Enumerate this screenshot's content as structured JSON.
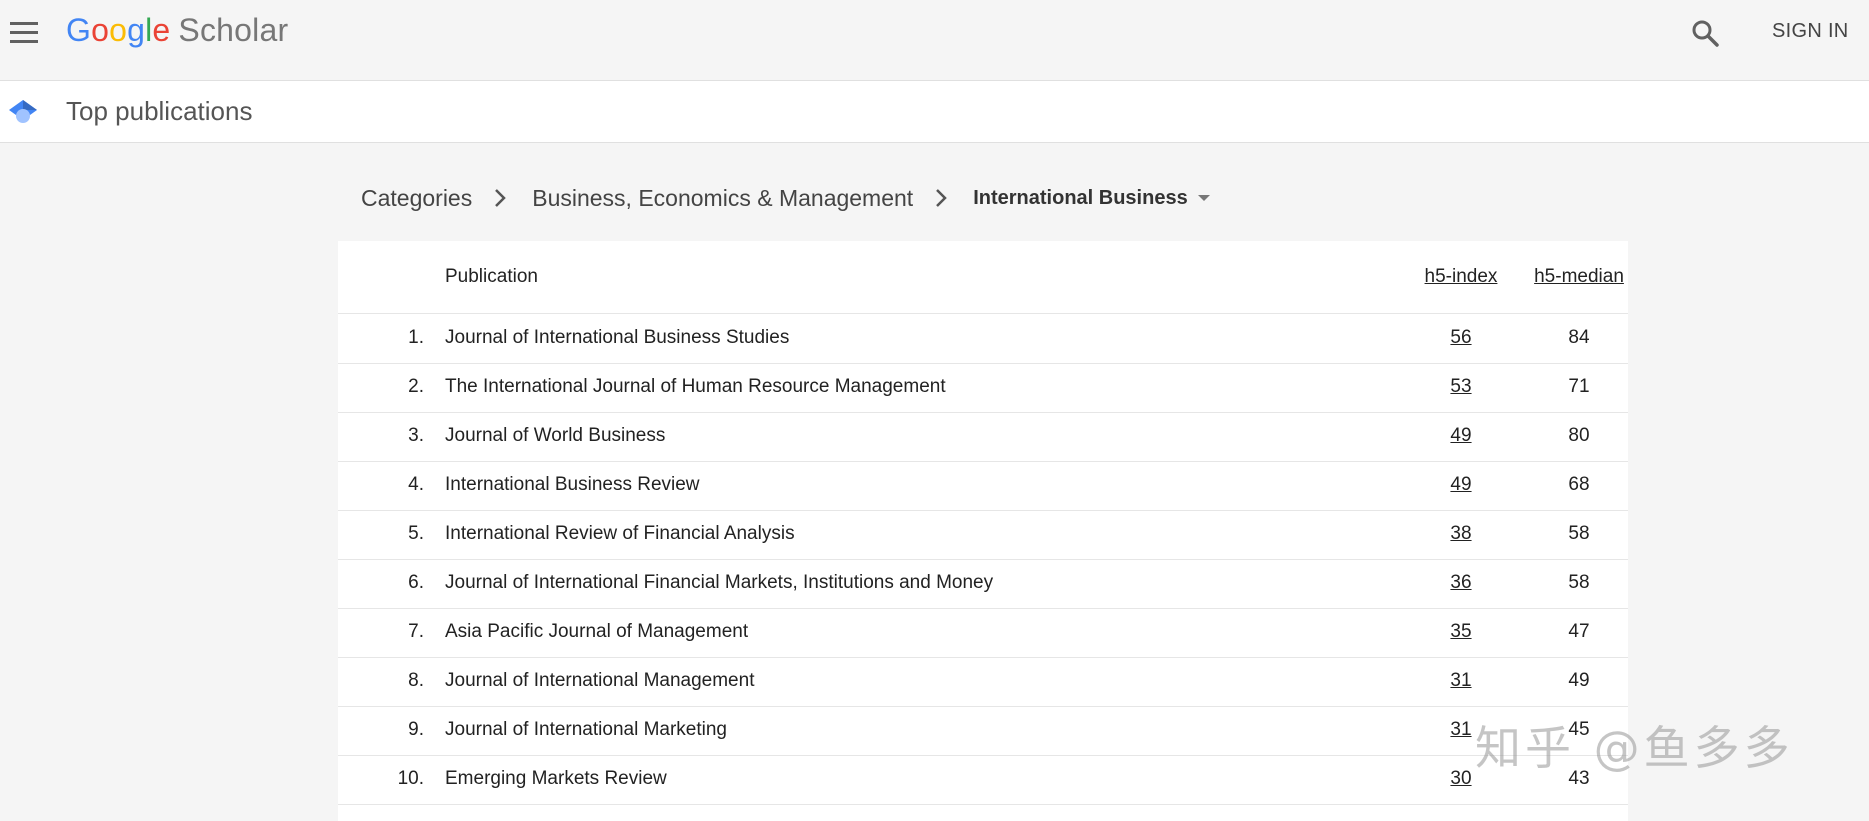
{
  "app": {
    "logo_google": [
      "G",
      "o",
      "o",
      "g",
      "l",
      "e"
    ],
    "logo_scholar": "Scholar",
    "sign_in": "SIGN IN",
    "menu_icon": "hamburger-menu-icon",
    "search_icon": "search-icon"
  },
  "subheader": {
    "title": "Top publications",
    "icon": "scholar-cap-icon"
  },
  "breadcrumb": {
    "level1": "Categories",
    "level2": "Business, Economics & Management",
    "current": "International Business",
    "separator_icon": "chevron-right-icon",
    "dropdown_icon": "dropdown-arrow-icon"
  },
  "table": {
    "headers": {
      "rank": "",
      "publication": "Publication",
      "h5_index": "h5-index",
      "h5_median": "h5-median"
    },
    "rows": [
      {
        "rank": "1.",
        "name": "Journal of International Business Studies",
        "h5_index": "56",
        "h5_median": "84"
      },
      {
        "rank": "2.",
        "name": "The International Journal of Human Resource Management",
        "h5_index": "53",
        "h5_median": "71"
      },
      {
        "rank": "3.",
        "name": "Journal of World Business",
        "h5_index": "49",
        "h5_median": "80"
      },
      {
        "rank": "4.",
        "name": "International Business Review",
        "h5_index": "49",
        "h5_median": "68"
      },
      {
        "rank": "5.",
        "name": "International Review of Financial Analysis",
        "h5_index": "38",
        "h5_median": "58"
      },
      {
        "rank": "6.",
        "name": "Journal of International Financial Markets, Institutions and Money",
        "h5_index": "36",
        "h5_median": "58"
      },
      {
        "rank": "7.",
        "name": "Asia Pacific Journal of Management",
        "h5_index": "35",
        "h5_median": "47"
      },
      {
        "rank": "8.",
        "name": "Journal of International Management",
        "h5_index": "31",
        "h5_median": "49"
      },
      {
        "rank": "9.",
        "name": "Journal of International Marketing",
        "h5_index": "31",
        "h5_median": "45"
      },
      {
        "rank": "10.",
        "name": "Emerging Markets Review",
        "h5_index": "30",
        "h5_median": "43"
      }
    ]
  },
  "watermark": "知乎 @鱼多多",
  "colors": {
    "google_blue": "#4285f4",
    "google_red": "#ea4335",
    "google_yellow": "#fbbc05",
    "google_green": "#34a853",
    "topbar_bg": "#f5f5f5",
    "table_bg": "#ffffff"
  }
}
